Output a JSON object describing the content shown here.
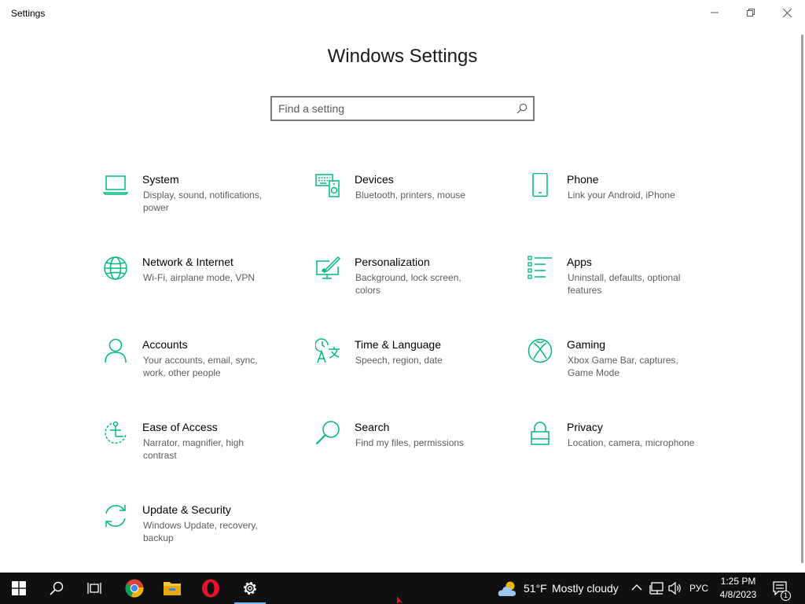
{
  "window": {
    "title": "Settings",
    "heading": "Windows Settings"
  },
  "search": {
    "placeholder": "Find a setting"
  },
  "accent_color": "#00b880",
  "tiles": [
    {
      "name": "System",
      "desc": "Display, sound, notifications, power",
      "icon": "laptop-icon"
    },
    {
      "name": "Devices",
      "desc": "Bluetooth, printers, mouse",
      "icon": "keyboard-speaker-icon"
    },
    {
      "name": "Phone",
      "desc": "Link your Android, iPhone",
      "icon": "phone-icon"
    },
    {
      "name": "Network & Internet",
      "desc": "Wi-Fi, airplane mode, VPN",
      "icon": "globe-icon"
    },
    {
      "name": "Personalization",
      "desc": "Background, lock screen, colors",
      "icon": "paintbrush-monitor-icon"
    },
    {
      "name": "Apps",
      "desc": "Uninstall, defaults, optional features",
      "icon": "apps-list-icon"
    },
    {
      "name": "Accounts",
      "desc": "Your accounts, email, sync, work, other people",
      "icon": "person-icon"
    },
    {
      "name": "Time & Language",
      "desc": "Speech, region, date",
      "icon": "time-language-icon"
    },
    {
      "name": "Gaming",
      "desc": "Xbox Game Bar, captures, Game Mode",
      "icon": "xbox-icon"
    },
    {
      "name": "Ease of Access",
      "desc": "Narrator, magnifier, high contrast",
      "icon": "ease-of-access-icon"
    },
    {
      "name": "Search",
      "desc": "Find my files, permissions",
      "icon": "magnifier-icon"
    },
    {
      "name": "Privacy",
      "desc": "Location, camera, microphone",
      "icon": "lock-icon"
    },
    {
      "name": "Update & Security",
      "desc": "Windows Update, recovery, backup",
      "icon": "sync-arrows-icon"
    }
  ],
  "taskbar": {
    "apps": [
      "start-icon",
      "search-icon",
      "task-view-icon",
      "chrome-icon",
      "file-explorer-icon",
      "opera-icon",
      "settings-gear-icon"
    ],
    "weather_temp": "51°F",
    "weather_text": "Mostly cloudy",
    "language": "РУС",
    "time": "1:25 PM",
    "date": "4/8/2023",
    "notification_count": "1"
  }
}
